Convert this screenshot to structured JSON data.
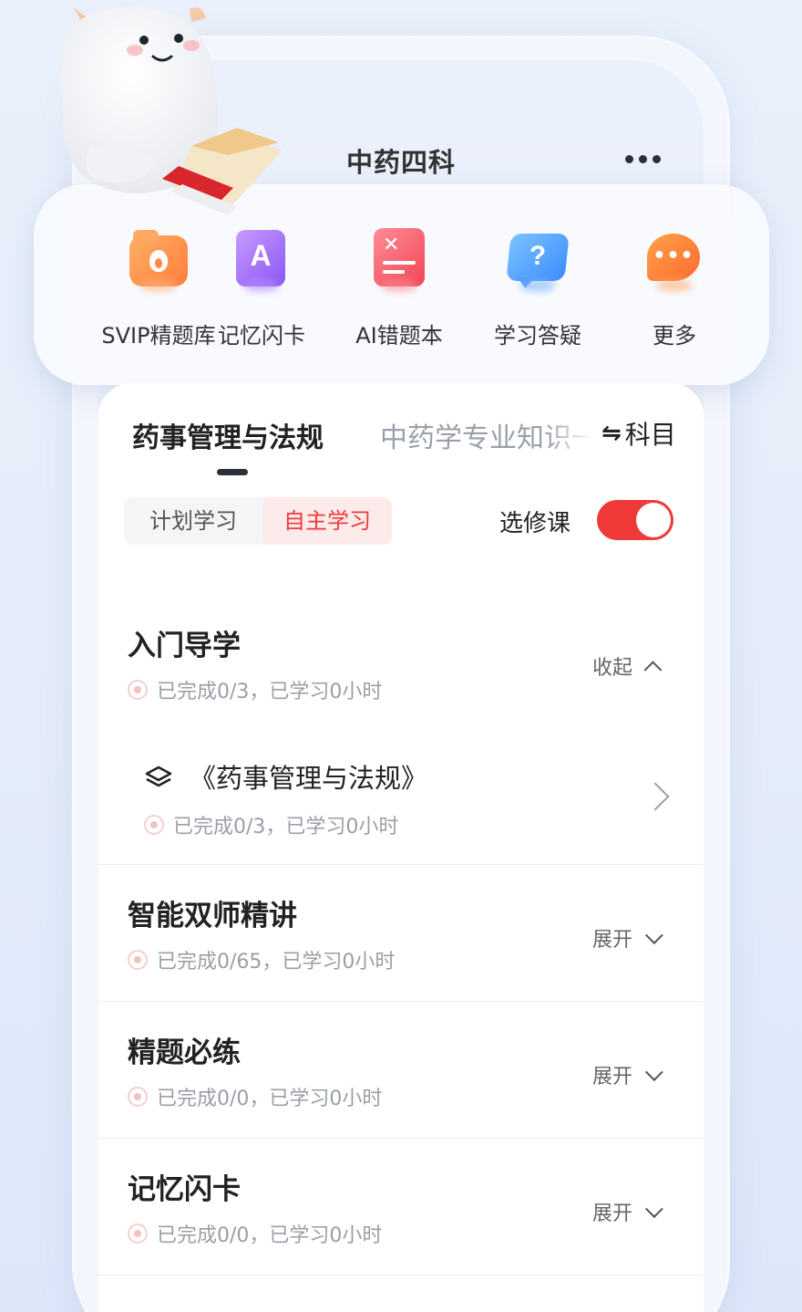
{
  "header": {
    "title": "中药四科",
    "more_icon": "more-dots-icon"
  },
  "quick_actions": [
    {
      "label": "SVIP精题库",
      "icon": "fire-folder-icon"
    },
    {
      "label": "记忆闪卡",
      "icon": "flashcard-icon"
    },
    {
      "label": "AI错题本",
      "icon": "error-book-icon"
    },
    {
      "label": "学习答疑",
      "icon": "question-bubble-icon"
    },
    {
      "label": "更多",
      "icon": "more-bubble-icon"
    }
  ],
  "subject_tabs": {
    "active": "药事管理与法规",
    "other": "中药学专业知识一",
    "switch_label": "科目"
  },
  "study_mode": {
    "options": [
      "计划学习",
      "自主学习"
    ],
    "selected": "自主学习"
  },
  "elective": {
    "label": "选修课",
    "enabled": true
  },
  "sections": [
    {
      "title": "入门导学",
      "meta": "已完成0/3，已学习0小时",
      "toggle": "收起",
      "expanded": true,
      "items": [
        {
          "title": "《药事管理与法规》",
          "meta": "已完成0/3，已学习0小时"
        }
      ]
    },
    {
      "title": "智能双师精讲",
      "meta": "已完成0/65，已学习0小时",
      "toggle": "展开",
      "expanded": false
    },
    {
      "title": "精题必练",
      "meta": "已完成0/0，已学习0小时",
      "toggle": "展开",
      "expanded": false
    },
    {
      "title": "记忆闪卡",
      "meta": "已完成0/0，已学习0小时",
      "toggle": "展开",
      "expanded": false
    }
  ],
  "colors": {
    "accent": "#f03a3a",
    "text": "#222222",
    "muted": "#9a9ea6"
  }
}
